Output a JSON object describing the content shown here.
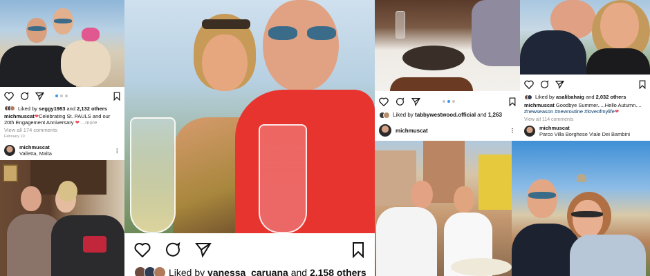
{
  "colors": {
    "instagram_blue": "#3897f0",
    "like_red": "#ed4956",
    "muted": "#8e8e8e",
    "tag": "#00376b"
  },
  "icons": [
    "heart-icon",
    "comment-icon",
    "share-icon",
    "bookmark-icon",
    "more-icon"
  ],
  "posts": {
    "p1": {
      "likes_prefix": "Liked by",
      "liked_by": "seggy1983",
      "likes_join": "and",
      "likes_count": "2,132 others",
      "caption_user": "michmuscat",
      "caption_text": "Celebrating St. PAULS and our 20th Engagement Anniversary",
      "caption_more": "...more",
      "comments": "View all 174 comments",
      "date": "February 10"
    },
    "p2": {
      "username": "michmuscat",
      "location": "Valletta, Malta"
    },
    "p3": {
      "likes_prefix": "Liked by",
      "liked_by": "vanessa_caruana",
      "likes_join": "and",
      "likes_count": "2,158 others"
    },
    "p4": {
      "likes_prefix": "Liked by",
      "liked_by": "tabbywestwood.official",
      "likes_join": "and",
      "likes_count": "1,263",
      "username": "michmuscat"
    },
    "p5": {
      "likes_prefix": "Liked by",
      "liked_by": "asalibahaig",
      "likes_join": "and",
      "likes_count": "2,032 others",
      "caption_user": "michmuscat",
      "caption_text": "Goodbye Summer.....Hello Autumn....",
      "caption_tags": "#newseason #newroutine #loveofmylife",
      "comments": "View all 114 comments",
      "username": "michmuscat",
      "location": "Parco Villa Borghese Viale Dei Bambini"
    }
  }
}
